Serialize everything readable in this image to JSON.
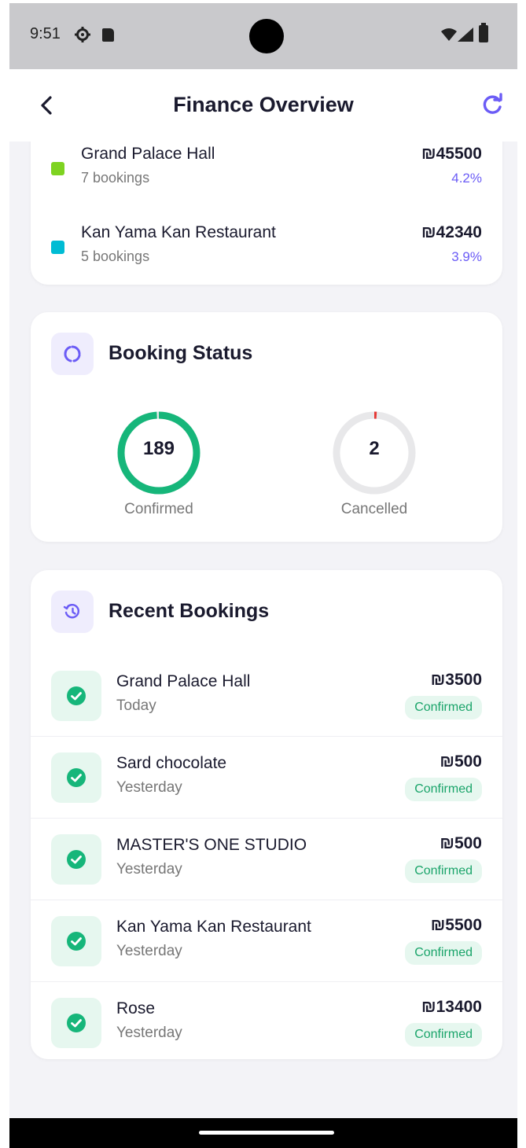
{
  "status_bar": {
    "time": "9:51"
  },
  "header": {
    "title": "Finance Overview"
  },
  "venues": [
    {
      "name": "Grand Palace Hall",
      "bookings": "7 bookings",
      "amount": "₪45500",
      "percent": "4.2%",
      "color": "#7ed321"
    },
    {
      "name": "Kan Yama Kan Restaurant",
      "bookings": "5 bookings",
      "amount": "₪42340",
      "percent": "3.9%",
      "color": "#00bcd4"
    }
  ],
  "booking_status": {
    "title": "Booking Status",
    "confirmed": {
      "value": "189",
      "label": "Confirmed",
      "color": "#16b67a",
      "fraction": 0.99
    },
    "cancelled": {
      "value": "2",
      "label": "Cancelled",
      "color": "#e53935",
      "fraction": 0.01
    }
  },
  "recent_bookings": {
    "title": "Recent Bookings",
    "items": [
      {
        "name": "Grand Palace Hall",
        "date": "Today",
        "amount": "₪3500",
        "status": "Confirmed"
      },
      {
        "name": "Sard chocolate",
        "date": "Yesterday",
        "amount": "₪500",
        "status": "Confirmed"
      },
      {
        "name": "MASTER'S ONE STUDIO",
        "date": "Yesterday",
        "amount": "₪500",
        "status": "Confirmed"
      },
      {
        "name": "Kan Yama Kan Restaurant",
        "date": "Yesterday",
        "amount": "₪5500",
        "status": "Confirmed"
      },
      {
        "name": "Rose",
        "date": "Yesterday",
        "amount": "₪13400",
        "status": "Confirmed"
      }
    ]
  },
  "colors": {
    "accent": "#6b5cf6",
    "success": "#16b67a",
    "danger": "#e53935",
    "background": "#f3f3f7"
  }
}
